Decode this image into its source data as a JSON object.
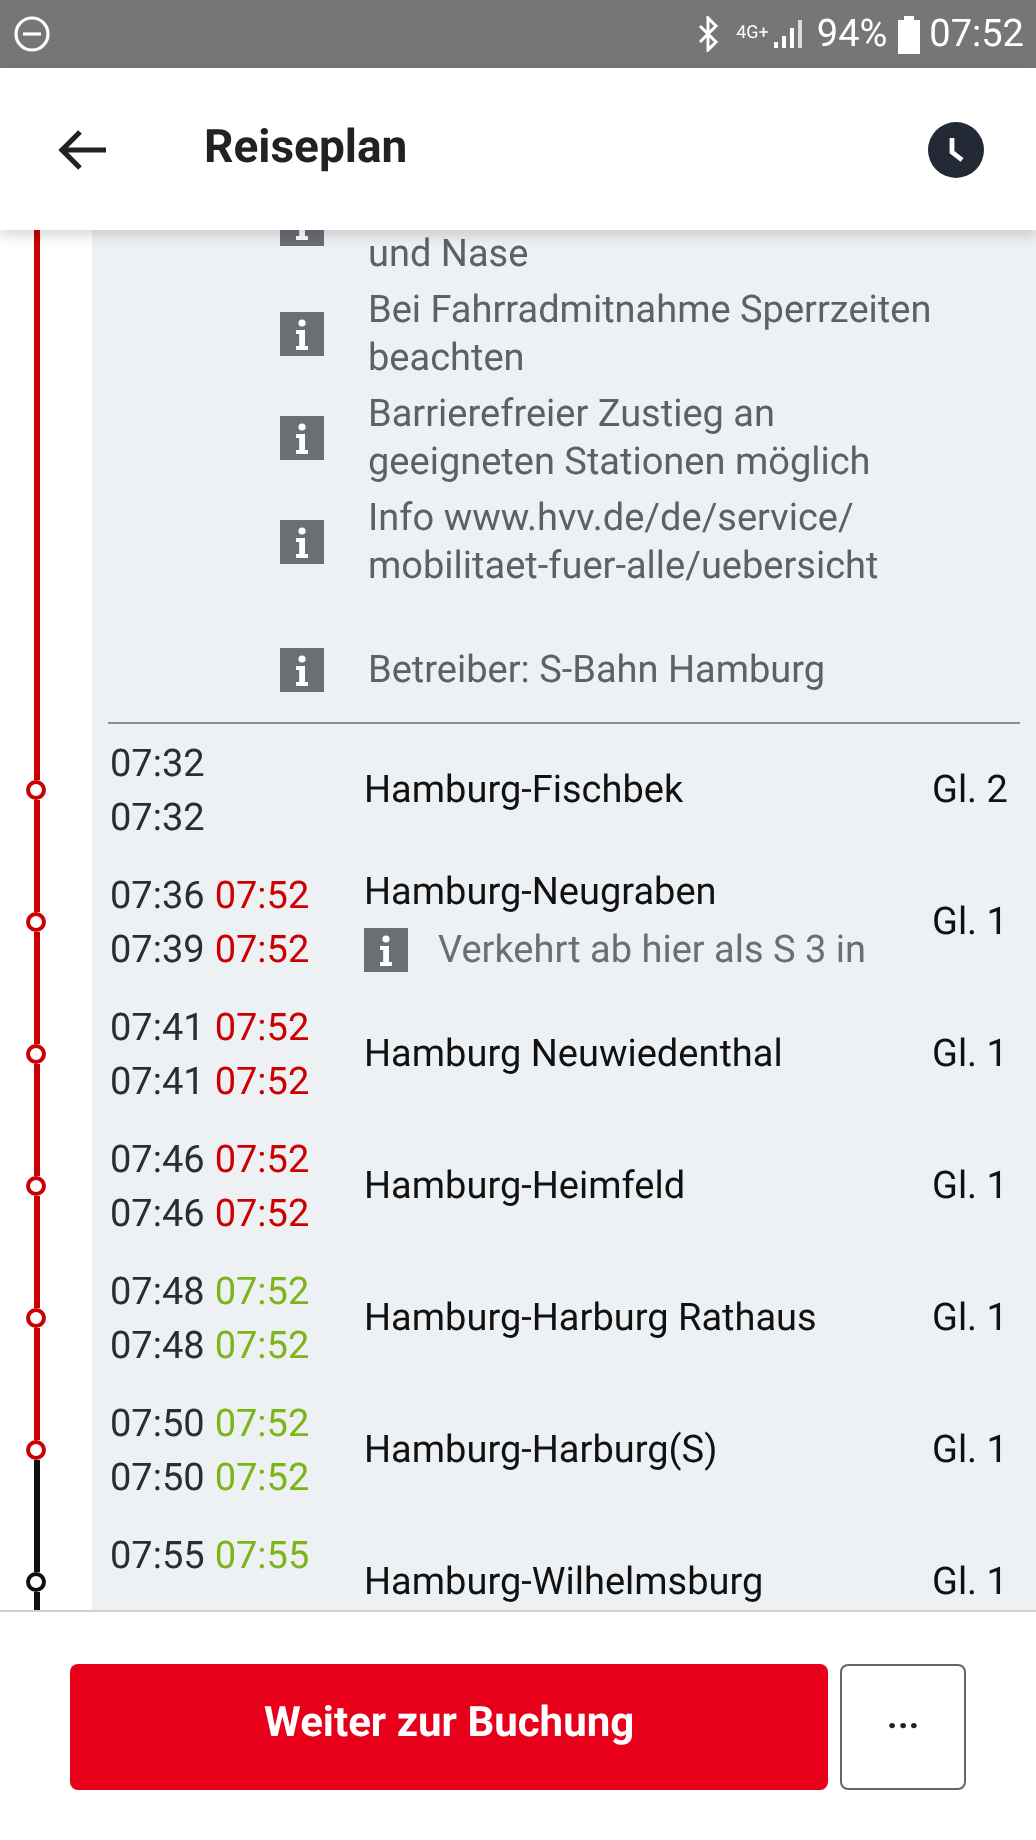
{
  "status_bar": {
    "battery": "94%",
    "time": "07:52",
    "network": "4G+"
  },
  "header": {
    "title": "Reiseplan"
  },
  "notes": [
    "und Nase",
    "Bei Fahrradmitnahme Sperrzeiten beachten",
    "Barrierefreier Zustieg an geeigneten Stationen möglich",
    "Info www.hvv.de/de/service/ mobilitaet-fuer-alle/uebersicht",
    "Betreiber: S-Bahn Hamburg"
  ],
  "stops": [
    {
      "times": [
        {
          "planned": "07:32"
        },
        {
          "planned": "07:32"
        }
      ],
      "name": "Hamburg-Fischbek",
      "platform": "Gl. 2",
      "color": "#cc0000"
    },
    {
      "times": [
        {
          "planned": "07:36",
          "actual": "07:52",
          "late": true
        },
        {
          "planned": "07:39",
          "actual": "07:52",
          "late": true
        }
      ],
      "name": "Hamburg-Neugraben",
      "note": "Verkehrt ab hier als S 3 in",
      "platform": "Gl. 1",
      "color": "#cc0000"
    },
    {
      "times": [
        {
          "planned": "07:41",
          "actual": "07:52",
          "late": true
        },
        {
          "planned": "07:41",
          "actual": "07:52",
          "late": true
        }
      ],
      "name": "Hamburg Neuwiedenthal",
      "platform": "Gl. 1",
      "color": "#cc0000"
    },
    {
      "times": [
        {
          "planned": "07:46",
          "actual": "07:52",
          "late": true
        },
        {
          "planned": "07:46",
          "actual": "07:52",
          "late": true
        }
      ],
      "name": "Hamburg-Heimfeld",
      "platform": "Gl. 1",
      "color": "#cc0000"
    },
    {
      "times": [
        {
          "planned": "07:48",
          "actual": "07:52",
          "late": false
        },
        {
          "planned": "07:48",
          "actual": "07:52",
          "late": false
        }
      ],
      "name": "Hamburg-Harburg Rathaus",
      "platform": "Gl. 1",
      "color": "#cc0000"
    },
    {
      "times": [
        {
          "planned": "07:50",
          "actual": "07:52",
          "late": false
        },
        {
          "planned": "07:50",
          "actual": "07:52",
          "late": false
        }
      ],
      "name": "Hamburg-Harburg(S)",
      "platform": "Gl. 1",
      "color": "#cc0000"
    },
    {
      "times": [
        {
          "planned": "07:55",
          "actual": "07:55",
          "late": false
        }
      ],
      "name": "Hamburg-Wilhelmsburg",
      "platform": "Gl. 1",
      "color": "#111111"
    }
  ],
  "footer": {
    "primary": "Weiter zur Buchung",
    "more": "···"
  }
}
